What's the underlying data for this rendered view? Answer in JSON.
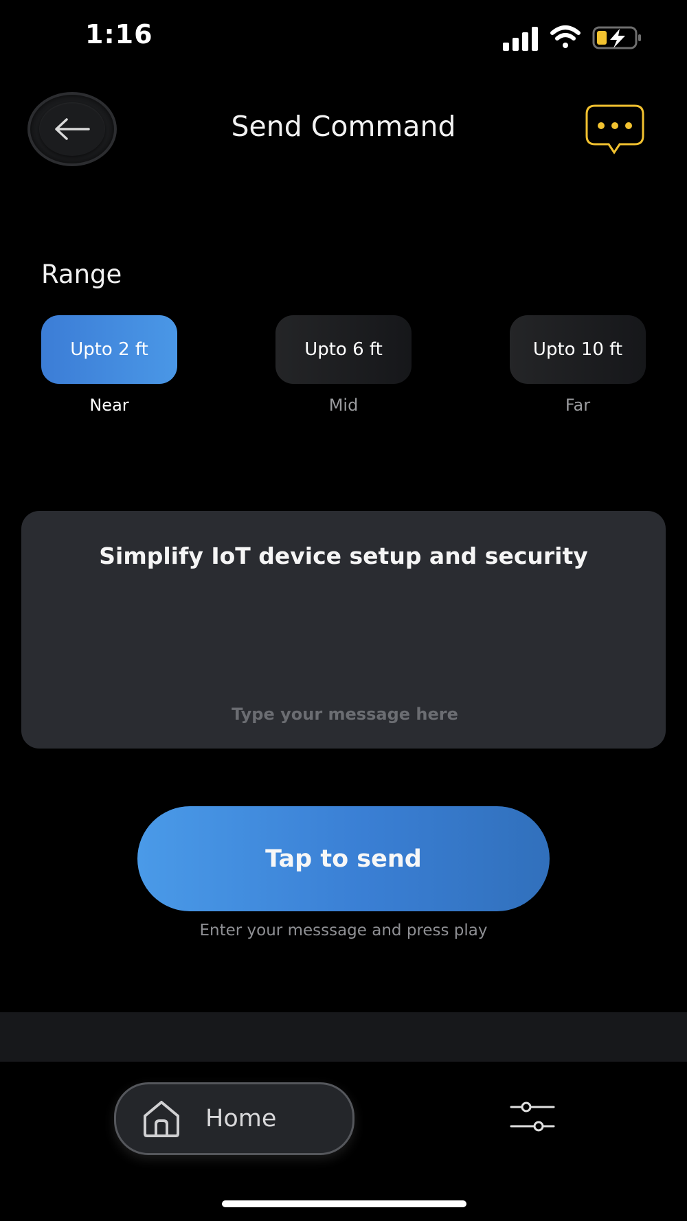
{
  "status_bar": {
    "time": "1:16",
    "signal_icon": "cellular-signal-icon",
    "wifi_icon": "wifi-icon",
    "battery_icon": "battery-charging-icon"
  },
  "header": {
    "title": "Send Command",
    "back_icon": "arrow-left-icon",
    "chat_icon": "chat-bubble-icon",
    "accent_color": "#f2c230"
  },
  "range": {
    "title": "Range",
    "options": [
      {
        "button_label": "Upto 2 ft",
        "caption": "Near",
        "selected": true
      },
      {
        "button_label": "Upto 6 ft",
        "caption": "Mid",
        "selected": false
      },
      {
        "button_label": "Upto 10 ft",
        "caption": "Far",
        "selected": false
      }
    ]
  },
  "message": {
    "title": "Simplify IoT device setup and security",
    "input_value": "",
    "input_placeholder": "Type your message here"
  },
  "send": {
    "button_label": "Tap to send",
    "hint": "Enter your messsage and press play"
  },
  "nav": {
    "home_label": "Home",
    "home_icon": "home-icon",
    "settings_icon": "sliders-icon"
  },
  "colors": {
    "primary_blue": "#4a97e6",
    "background": "#000000",
    "card": "#2a2c31"
  }
}
